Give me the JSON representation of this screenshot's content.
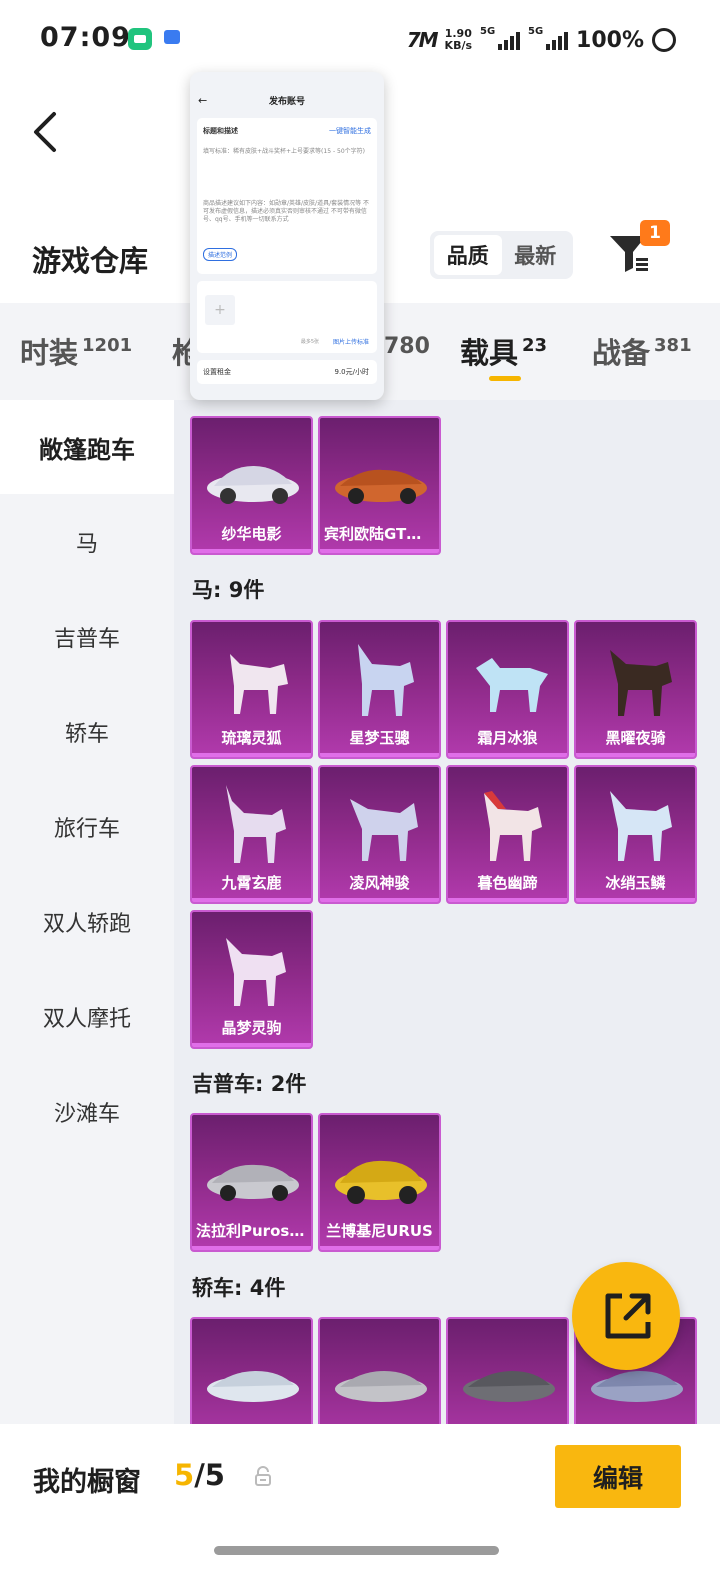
{
  "status_bar": {
    "time": "07:09",
    "speed_value": "1.90",
    "speed_unit": "KB/s",
    "net1": "5G",
    "net2": "5G",
    "battery": "100%"
  },
  "header": {
    "title": "游戏仓库",
    "sort_tabs": [
      "品质",
      "最新"
    ],
    "sort_active": "品质",
    "filter_badge": "1"
  },
  "category_tabs": [
    {
      "label": "时装",
      "count": "1201"
    },
    {
      "label": "枪",
      "count": ""
    },
    {
      "label": "",
      "count": "780"
    },
    {
      "label": "载具",
      "count": "23",
      "active": true
    },
    {
      "label": "战备",
      "count": "381"
    }
  ],
  "sidebar": {
    "items": [
      "敞篷跑车",
      "马",
      "吉普车",
      "轿车",
      "旅行车",
      "双人轿跑",
      "双人摩托",
      "沙滩车"
    ],
    "active": "敞篷跑车"
  },
  "sections": [
    {
      "title": "",
      "items": [
        "纱华电影",
        "宾利欧陆GT敞篷版"
      ]
    },
    {
      "title": "马: 9件",
      "items": [
        "琉璃灵狐",
        "星梦玉骢",
        "霜月冰狼",
        "黑曜夜骑",
        "九霄玄鹿",
        "凌风神骏",
        "暮色幽蹄",
        "冰绡玉鳞",
        "晶梦灵驹"
      ]
    },
    {
      "title": "吉普车: 2件",
      "items": [
        "法拉利Purosangue",
        "兰博基尼URUS"
      ]
    },
    {
      "title": "轿车: 4件",
      "items": [
        "",
        "",
        "",
        ""
      ]
    }
  ],
  "bottom_bar": {
    "label": "我的橱窗",
    "count_current": "5",
    "count_sep": "/5",
    "edit_label": "编辑"
  },
  "popup": {
    "title": "发布账号",
    "section_label": "标题和描述",
    "ai_label": "一键智能生成",
    "hint1": "填写标准：稀有皮肤+战斗奖杯+上号要求等(15 - 50个字符)",
    "hint2": "商品描述建议如下内容：如勋章/英雄/皮肤/道具/套装情况等 不可发布虚假信息，描述必须真实否则审核不通过 不可带有微信号、qq号、手机等一切联系方式",
    "guide_label": "描述范例",
    "more_label": "最多5张",
    "upload_label": "图片上传标准",
    "rent_label": "设置租金",
    "rent_value": "9.0元/小时"
  },
  "colors": {
    "accent": "#f9b70f",
    "badge": "#ff7a1a",
    "card_purple": "#8d2a88",
    "card_border": "#c95ad0"
  }
}
